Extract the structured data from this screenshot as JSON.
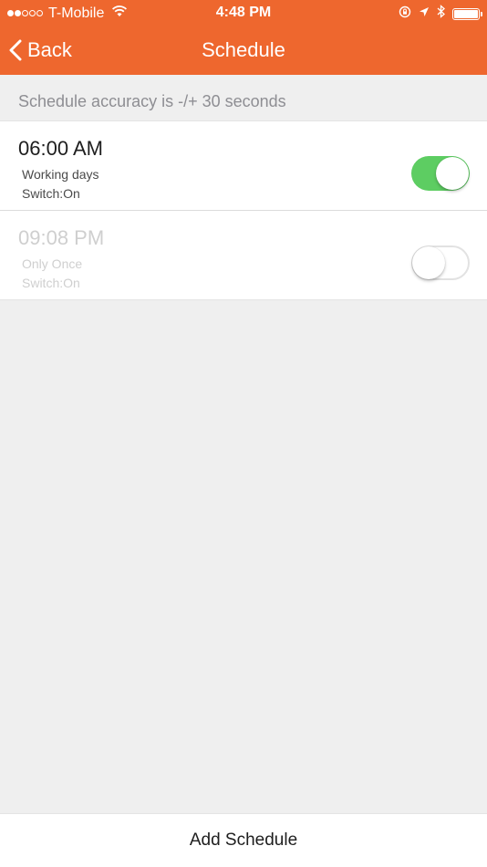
{
  "status_bar": {
    "carrier": "T-Mobile",
    "time": "4:48 PM",
    "signal_bars_filled": 2,
    "signal_bars_total": 5,
    "icons": [
      "wifi-icon",
      "orientation-lock-icon",
      "location-arrow-icon",
      "bluetooth-icon",
      "battery-icon"
    ]
  },
  "nav": {
    "back_label": "Back",
    "title": "Schedule",
    "color": "#ee672e"
  },
  "accuracy_note": "Schedule accuracy is -/+ 30 seconds",
  "schedules": [
    {
      "time": "06:00 AM",
      "repeat": "Working days",
      "action": "Switch:On",
      "enabled": true
    },
    {
      "time": "09:08 PM",
      "repeat": "Only Once",
      "action": "Switch:On",
      "enabled": false
    }
  ],
  "footer": {
    "add_label": "Add Schedule"
  },
  "colors": {
    "accent": "#ee672e",
    "toggle_on": "#5dcd62",
    "background": "#efefef"
  }
}
